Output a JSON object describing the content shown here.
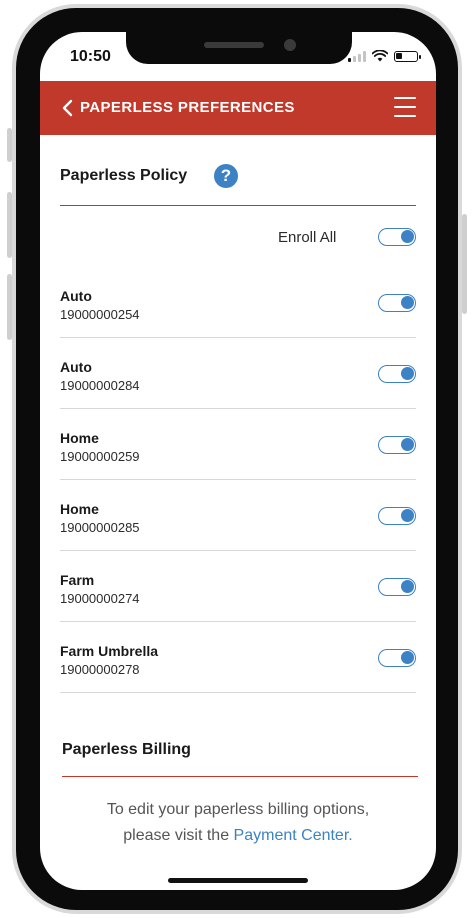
{
  "status_bar": {
    "time": "10:50"
  },
  "header": {
    "title": "PAPERLESS PREFERENCES"
  },
  "policy_section": {
    "title": "Paperless Policy",
    "help_glyph": "?",
    "enroll_all_label": "Enroll All",
    "enroll_all_on": true,
    "policies": [
      {
        "name": "Auto",
        "number": "19000000254",
        "enabled": true
      },
      {
        "name": "Auto",
        "number": "19000000284",
        "enabled": true
      },
      {
        "name": "Home",
        "number": "19000000259",
        "enabled": true
      },
      {
        "name": "Home",
        "number": "19000000285",
        "enabled": true
      },
      {
        "name": "Farm",
        "number": "19000000274",
        "enabled": true
      },
      {
        "name": "Farm Umbrella",
        "number": "19000000278",
        "enabled": true
      }
    ]
  },
  "billing_section": {
    "title": "Paperless Billing",
    "text_line1": "To edit your paperless billing options,",
    "text_line2_prefix": "please visit the ",
    "link_text": "Payment Center",
    "text_line2_suffix": "."
  },
  "colors": {
    "brand_red": "#c0392b",
    "accent_blue": "#3d82c4"
  },
  "icons": {
    "back": "chevron-left-icon",
    "menu": "hamburger-menu-icon",
    "help": "question-circle-icon"
  }
}
